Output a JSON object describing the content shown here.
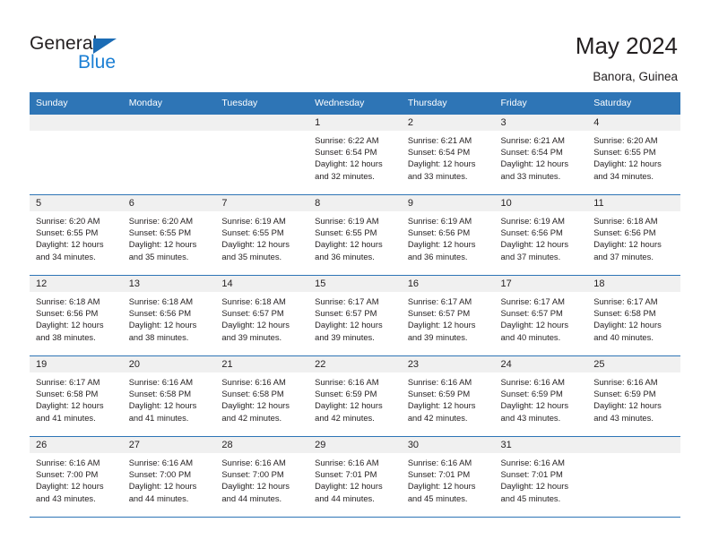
{
  "brand": {
    "name_part1": "General",
    "name_part2": "Blue",
    "accent_color": "#1b7fd4",
    "triangle_color": "#1b6cb5"
  },
  "header": {
    "title": "May 2024",
    "location": "Banora, Guinea"
  },
  "theme": {
    "header_bg": "#2e75b6",
    "header_text": "#ffffff",
    "daynum_band_bg": "#f0f0f0",
    "grid_line": "#2e75b6",
    "body_text": "#231f20"
  },
  "weekdays": [
    "Sunday",
    "Monday",
    "Tuesday",
    "Wednesday",
    "Thursday",
    "Friday",
    "Saturday"
  ],
  "weeks": [
    [
      {
        "day": "",
        "sunrise": "",
        "sunset": "",
        "daylight1": "",
        "daylight2": ""
      },
      {
        "day": "",
        "sunrise": "",
        "sunset": "",
        "daylight1": "",
        "daylight2": ""
      },
      {
        "day": "",
        "sunrise": "",
        "sunset": "",
        "daylight1": "",
        "daylight2": ""
      },
      {
        "day": "1",
        "sunrise": "Sunrise: 6:22 AM",
        "sunset": "Sunset: 6:54 PM",
        "daylight1": "Daylight: 12 hours",
        "daylight2": "and 32 minutes."
      },
      {
        "day": "2",
        "sunrise": "Sunrise: 6:21 AM",
        "sunset": "Sunset: 6:54 PM",
        "daylight1": "Daylight: 12 hours",
        "daylight2": "and 33 minutes."
      },
      {
        "day": "3",
        "sunrise": "Sunrise: 6:21 AM",
        "sunset": "Sunset: 6:54 PM",
        "daylight1": "Daylight: 12 hours",
        "daylight2": "and 33 minutes."
      },
      {
        "day": "4",
        "sunrise": "Sunrise: 6:20 AM",
        "sunset": "Sunset: 6:55 PM",
        "daylight1": "Daylight: 12 hours",
        "daylight2": "and 34 minutes."
      }
    ],
    [
      {
        "day": "5",
        "sunrise": "Sunrise: 6:20 AM",
        "sunset": "Sunset: 6:55 PM",
        "daylight1": "Daylight: 12 hours",
        "daylight2": "and 34 minutes."
      },
      {
        "day": "6",
        "sunrise": "Sunrise: 6:20 AM",
        "sunset": "Sunset: 6:55 PM",
        "daylight1": "Daylight: 12 hours",
        "daylight2": "and 35 minutes."
      },
      {
        "day": "7",
        "sunrise": "Sunrise: 6:19 AM",
        "sunset": "Sunset: 6:55 PM",
        "daylight1": "Daylight: 12 hours",
        "daylight2": "and 35 minutes."
      },
      {
        "day": "8",
        "sunrise": "Sunrise: 6:19 AM",
        "sunset": "Sunset: 6:55 PM",
        "daylight1": "Daylight: 12 hours",
        "daylight2": "and 36 minutes."
      },
      {
        "day": "9",
        "sunrise": "Sunrise: 6:19 AM",
        "sunset": "Sunset: 6:56 PM",
        "daylight1": "Daylight: 12 hours",
        "daylight2": "and 36 minutes."
      },
      {
        "day": "10",
        "sunrise": "Sunrise: 6:19 AM",
        "sunset": "Sunset: 6:56 PM",
        "daylight1": "Daylight: 12 hours",
        "daylight2": "and 37 minutes."
      },
      {
        "day": "11",
        "sunrise": "Sunrise: 6:18 AM",
        "sunset": "Sunset: 6:56 PM",
        "daylight1": "Daylight: 12 hours",
        "daylight2": "and 37 minutes."
      }
    ],
    [
      {
        "day": "12",
        "sunrise": "Sunrise: 6:18 AM",
        "sunset": "Sunset: 6:56 PM",
        "daylight1": "Daylight: 12 hours",
        "daylight2": "and 38 minutes."
      },
      {
        "day": "13",
        "sunrise": "Sunrise: 6:18 AM",
        "sunset": "Sunset: 6:56 PM",
        "daylight1": "Daylight: 12 hours",
        "daylight2": "and 38 minutes."
      },
      {
        "day": "14",
        "sunrise": "Sunrise: 6:18 AM",
        "sunset": "Sunset: 6:57 PM",
        "daylight1": "Daylight: 12 hours",
        "daylight2": "and 39 minutes."
      },
      {
        "day": "15",
        "sunrise": "Sunrise: 6:17 AM",
        "sunset": "Sunset: 6:57 PM",
        "daylight1": "Daylight: 12 hours",
        "daylight2": "and 39 minutes."
      },
      {
        "day": "16",
        "sunrise": "Sunrise: 6:17 AM",
        "sunset": "Sunset: 6:57 PM",
        "daylight1": "Daylight: 12 hours",
        "daylight2": "and 39 minutes."
      },
      {
        "day": "17",
        "sunrise": "Sunrise: 6:17 AM",
        "sunset": "Sunset: 6:57 PM",
        "daylight1": "Daylight: 12 hours",
        "daylight2": "and 40 minutes."
      },
      {
        "day": "18",
        "sunrise": "Sunrise: 6:17 AM",
        "sunset": "Sunset: 6:58 PM",
        "daylight1": "Daylight: 12 hours",
        "daylight2": "and 40 minutes."
      }
    ],
    [
      {
        "day": "19",
        "sunrise": "Sunrise: 6:17 AM",
        "sunset": "Sunset: 6:58 PM",
        "daylight1": "Daylight: 12 hours",
        "daylight2": "and 41 minutes."
      },
      {
        "day": "20",
        "sunrise": "Sunrise: 6:16 AM",
        "sunset": "Sunset: 6:58 PM",
        "daylight1": "Daylight: 12 hours",
        "daylight2": "and 41 minutes."
      },
      {
        "day": "21",
        "sunrise": "Sunrise: 6:16 AM",
        "sunset": "Sunset: 6:58 PM",
        "daylight1": "Daylight: 12 hours",
        "daylight2": "and 42 minutes."
      },
      {
        "day": "22",
        "sunrise": "Sunrise: 6:16 AM",
        "sunset": "Sunset: 6:59 PM",
        "daylight1": "Daylight: 12 hours",
        "daylight2": "and 42 minutes."
      },
      {
        "day": "23",
        "sunrise": "Sunrise: 6:16 AM",
        "sunset": "Sunset: 6:59 PM",
        "daylight1": "Daylight: 12 hours",
        "daylight2": "and 42 minutes."
      },
      {
        "day": "24",
        "sunrise": "Sunrise: 6:16 AM",
        "sunset": "Sunset: 6:59 PM",
        "daylight1": "Daylight: 12 hours",
        "daylight2": "and 43 minutes."
      },
      {
        "day": "25",
        "sunrise": "Sunrise: 6:16 AM",
        "sunset": "Sunset: 6:59 PM",
        "daylight1": "Daylight: 12 hours",
        "daylight2": "and 43 minutes."
      }
    ],
    [
      {
        "day": "26",
        "sunrise": "Sunrise: 6:16 AM",
        "sunset": "Sunset: 7:00 PM",
        "daylight1": "Daylight: 12 hours",
        "daylight2": "and 43 minutes."
      },
      {
        "day": "27",
        "sunrise": "Sunrise: 6:16 AM",
        "sunset": "Sunset: 7:00 PM",
        "daylight1": "Daylight: 12 hours",
        "daylight2": "and 44 minutes."
      },
      {
        "day": "28",
        "sunrise": "Sunrise: 6:16 AM",
        "sunset": "Sunset: 7:00 PM",
        "daylight1": "Daylight: 12 hours",
        "daylight2": "and 44 minutes."
      },
      {
        "day": "29",
        "sunrise": "Sunrise: 6:16 AM",
        "sunset": "Sunset: 7:01 PM",
        "daylight1": "Daylight: 12 hours",
        "daylight2": "and 44 minutes."
      },
      {
        "day": "30",
        "sunrise": "Sunrise: 6:16 AM",
        "sunset": "Sunset: 7:01 PM",
        "daylight1": "Daylight: 12 hours",
        "daylight2": "and 45 minutes."
      },
      {
        "day": "31",
        "sunrise": "Sunrise: 6:16 AM",
        "sunset": "Sunset: 7:01 PM",
        "daylight1": "Daylight: 12 hours",
        "daylight2": "and 45 minutes."
      },
      {
        "day": "",
        "sunrise": "",
        "sunset": "",
        "daylight1": "",
        "daylight2": ""
      }
    ]
  ]
}
